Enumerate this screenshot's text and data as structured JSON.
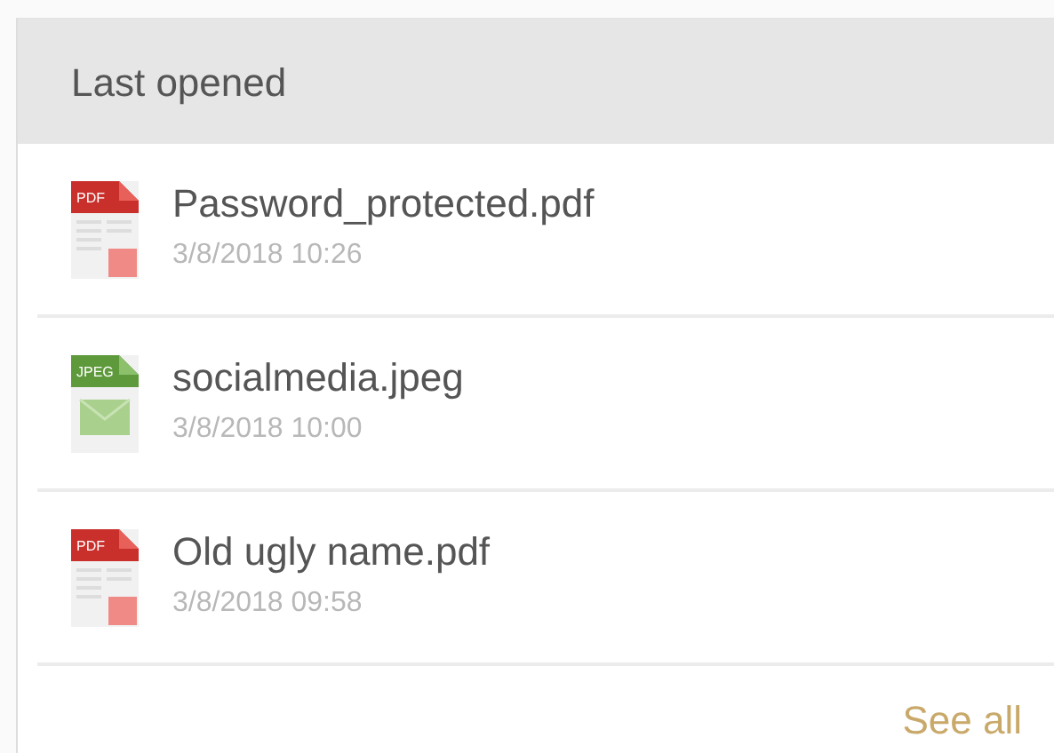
{
  "panel": {
    "title": "Last opened",
    "files": [
      {
        "kind": "pdf",
        "badge": "PDF",
        "name": "Password_protected.pdf",
        "date": "3/8/2018 10:26"
      },
      {
        "kind": "image",
        "badge": "JPEG",
        "name": "socialmedia.jpeg",
        "date": "3/8/2018 10:00"
      },
      {
        "kind": "pdf",
        "badge": "PDF",
        "name": "Old ugly name.pdf",
        "date": "3/8/2018 09:58"
      }
    ],
    "footer_link": "See all"
  }
}
